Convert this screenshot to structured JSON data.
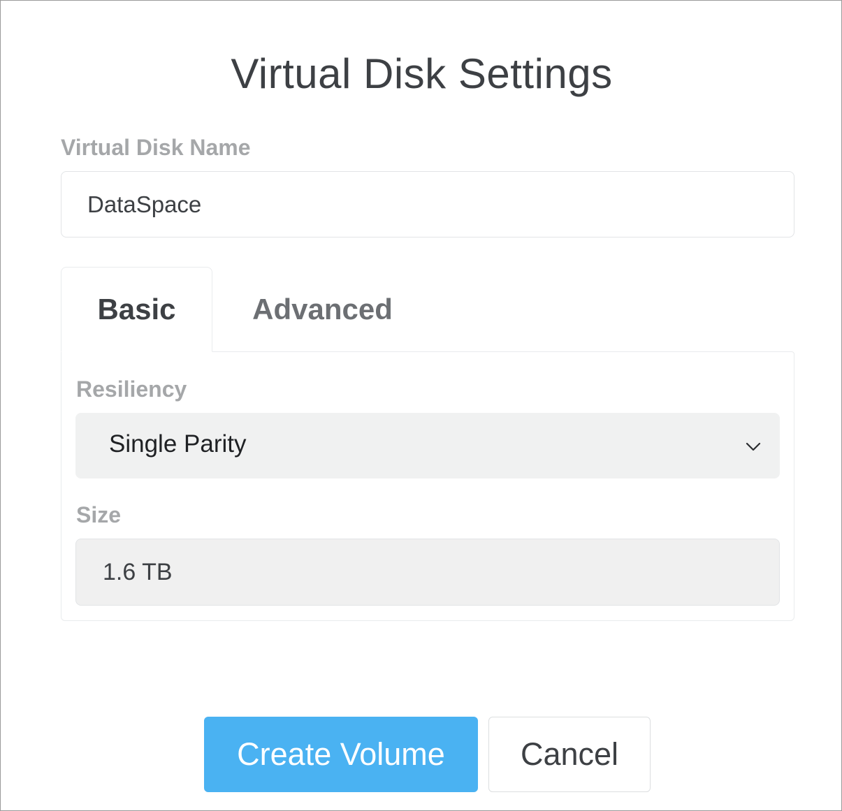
{
  "dialog": {
    "title": "Virtual Disk Settings"
  },
  "name_field": {
    "label": "Virtual Disk Name",
    "value": "DataSpace"
  },
  "tabs": [
    {
      "label": "Basic",
      "active": true
    },
    {
      "label": "Advanced",
      "active": false
    }
  ],
  "resiliency": {
    "label": "Resiliency",
    "selected": "Single Parity",
    "icon": "chevron-down-icon"
  },
  "size": {
    "label": "Size",
    "value": "1.6 TB"
  },
  "buttons": {
    "primary_label": "Create Volume",
    "secondary_label": "Cancel"
  },
  "colors": {
    "accent": "#4ab2f2",
    "text": "#3d4044",
    "label": "#a5a7a9"
  }
}
